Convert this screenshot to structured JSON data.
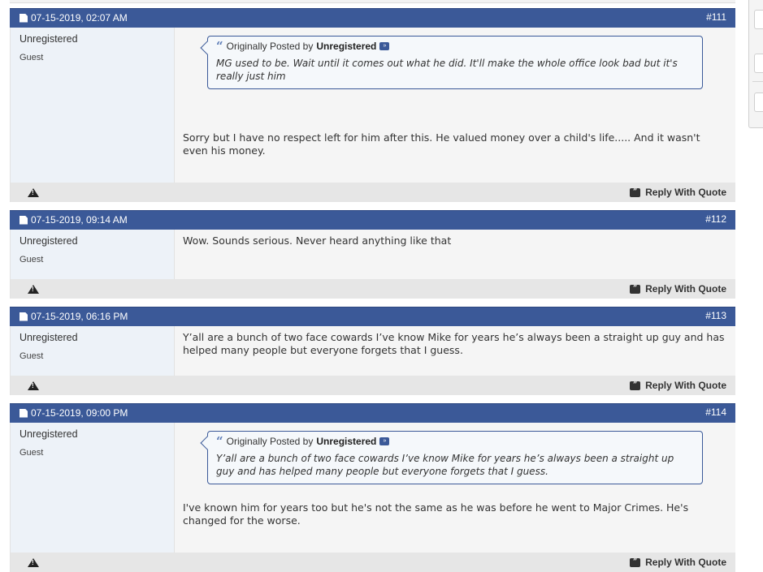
{
  "posts": [
    {
      "date": "07-15-2019, 02:07 AM",
      "number": "#111",
      "username": "Unregistered",
      "usertitle": "Guest",
      "quote": {
        "prefix": "Originally Posted by",
        "author": "Unregistered",
        "text": "MG used to be. Wait until it comes out what he did. It'll make the whole office look bad but it's really just him"
      },
      "message": "Sorry but I have no respect left for him after this. He valued money over a child's life..... And it wasn't even his money."
    },
    {
      "date": "07-15-2019, 09:14 AM",
      "number": "#112",
      "username": "Unregistered",
      "usertitle": "Guest",
      "message": "Wow. Sounds serious. Never heard anything like that"
    },
    {
      "date": "07-15-2019, 06:16 PM",
      "number": "#113",
      "username": "Unregistered",
      "usertitle": "Guest",
      "message": "Y’all are a bunch of two face cowards I’ve know Mike for years he’s always been a straight up guy and has helped many people but everyone forgets that I guess."
    },
    {
      "date": "07-15-2019, 09:00 PM",
      "number": "#114",
      "username": "Unregistered",
      "usertitle": "Guest",
      "quote": {
        "prefix": "Originally Posted by",
        "author": "Unregistered",
        "text": "Y’all are a bunch of two face cowards I’ve know Mike for years he’s always been a straight up guy and has helped many people but everyone forgets that I guess."
      },
      "message": "I've known him for years too but he's not the same as he was before he went to Major Crimes. He's changed for the worse."
    }
  ],
  "labels": {
    "reply_with_quote": "Reply With Quote"
  },
  "icons": {
    "date": "document-icon",
    "quote": "quote-icon",
    "view_post": "view-post-icon",
    "report": "warning-icon",
    "reply": "reply-quote-icon"
  },
  "colors": {
    "header": "#3b5998",
    "userinfo_bg": "#edf2f8",
    "content_bg": "#f5f5f5",
    "footer_bg": "#e6e6e6"
  }
}
